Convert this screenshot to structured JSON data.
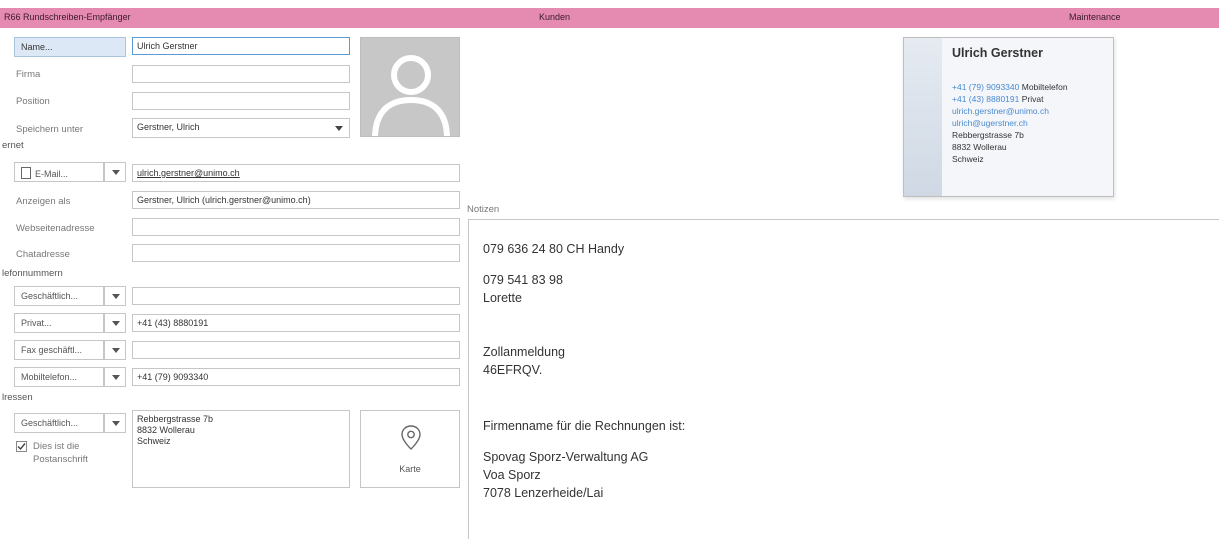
{
  "header": {
    "section1": "R66 Rundschreiben-Empfänger",
    "section2": "Kunden",
    "section3": "Maintenance"
  },
  "form": {
    "name_button": "Name...",
    "name_value": "Ulrich Gerstner",
    "firma_label": "Firma",
    "firma_value": "",
    "position_label": "Position",
    "position_value": "",
    "speichern_label": "Speichern unter",
    "speichern_value": "Gerstner, Ulrich",
    "internet_section": "ernet",
    "email_button": "E-Mail...",
    "email_value": "ulrich.gerstner@unimo.ch",
    "anzeigen_label": "Anzeigen als",
    "anzeigen_value": "Gerstner, Ulrich (ulrich.gerstner@unimo.ch)",
    "webseite_label": "Webseitenadresse",
    "webseite_value": "",
    "chat_label": "Chatadresse",
    "chat_value": "",
    "phone_section": "lefonnummern",
    "phones": [
      {
        "type": "Geschäftlich...",
        "value": ""
      },
      {
        "type": "Privat...",
        "value": "+41 (43) 8880191"
      },
      {
        "type": "Fax geschäftl...",
        "value": ""
      },
      {
        "type": "Mobiltelefon...",
        "value": "+41 (79) 9093340"
      }
    ],
    "address_section": "lressen",
    "address_type": "Geschäftlich...",
    "address_lines": [
      "Rebbergstrasse 7b",
      "8832 Wollerau",
      "Schweiz"
    ],
    "postal_check_label1": "Dies ist die",
    "postal_check_label2": "Postanschrift",
    "map_button": "Karte"
  },
  "notes": {
    "label": "Notizen",
    "lines": [
      "079 636 24 80 CH Handy",
      "079 541 83 98",
      "Lorette",
      "Zollanmeldung",
      "46EFRQV.",
      "Firmenname für die Rechnungen ist:",
      "Spovag Sporz-Verwaltung AG",
      "Voa Sporz",
      "7078 Lenzerheide/Lai"
    ]
  },
  "card": {
    "name": "Ulrich Gerstner",
    "mobile_number": "+41 (79) 9093340",
    "mobile_label": "Mobiltelefon",
    "private_number": "+41 (43) 8880191",
    "private_label": "Privat",
    "email1": "ulrich.gerstner@unimo.ch",
    "email2": "ulrich@ugerstner.ch",
    "address": [
      "Rebbergstrasse 7b",
      "8832 Wollerau",
      "Schweiz"
    ]
  },
  "colors": {
    "header_band": "#e58ab1",
    "link_blue": "#4a8ad0"
  }
}
